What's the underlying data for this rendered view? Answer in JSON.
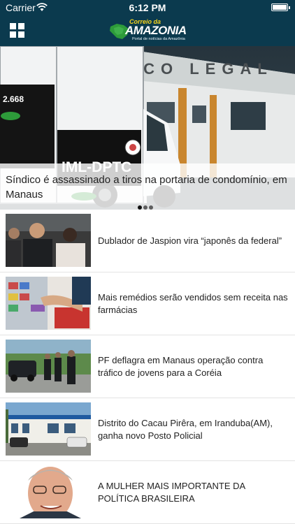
{
  "status_bar": {
    "carrier": "Carrier",
    "time": "6:12 PM"
  },
  "nav": {
    "menu_icon": "grid-icon",
    "logo": {
      "line1": "Correio da",
      "line2": "AMAZONIA",
      "tagline": "Portal de notícias da Amazônia"
    }
  },
  "hero": {
    "title": "Síndico é assassinado a tiros na portaria de condomínio, em Manaus",
    "truck_text": "IML-DPTC",
    "truck_code": "2.668",
    "building_text": "ICO LEGAL",
    "pager": {
      "count": 3,
      "active": 0
    }
  },
  "articles": [
    {
      "title": "Dublador de Jaspion vira “japonês da federal”"
    },
    {
      "title": "Mais remédios serão vendidos sem receita nas farmácias"
    },
    {
      "title": "PF deflagra em Manaus operação contra tráfico de jovens para a Coréia"
    },
    {
      "title": "Distrito do Cacau Pirêra, em Iranduba(AM), ganha novo Posto Policial"
    },
    {
      "title": "A MULHER MAIS IMPORTANTE DA POLÍTICA BRASILEIRA"
    }
  ],
  "colors": {
    "nav_bg": "#0b3a4e",
    "logo_yellow": "#f3d21c",
    "logo_green": "#2d9b3a"
  }
}
